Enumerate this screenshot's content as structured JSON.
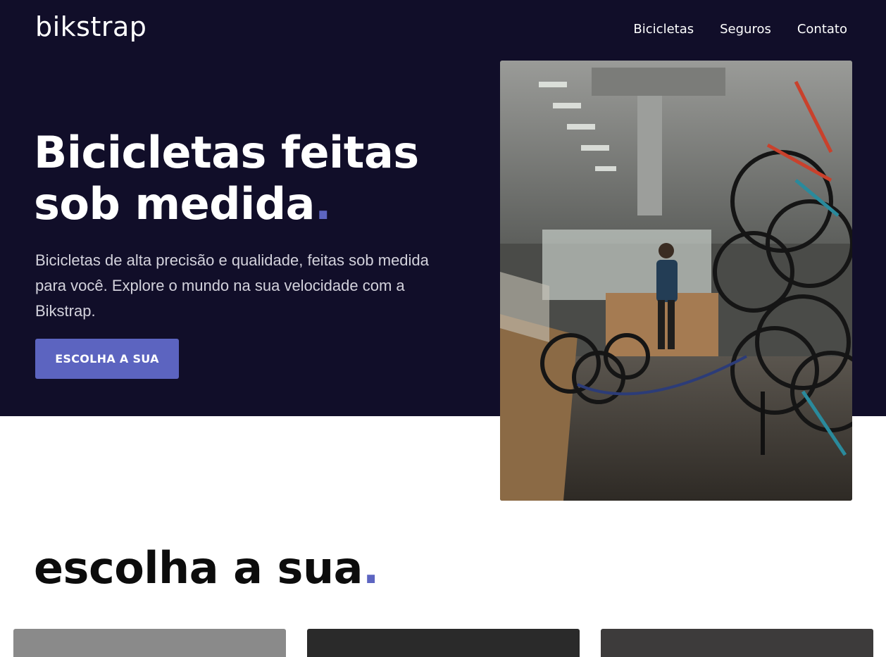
{
  "header": {
    "logo": "bikstrap",
    "nav": [
      "Bicicletas",
      "Seguros",
      "Contato"
    ]
  },
  "hero": {
    "title_line1": "Bicicletas feitas",
    "title_line2": "sob medida",
    "title_dot": ".",
    "description": "Bicicletas de alta precisão e qualidade, feitas sob medida para você. Explore o mundo na sua velocidade com a Bikstrap.",
    "cta_label": "ESCOLHA A SUA"
  },
  "section": {
    "title": "escolha a sua",
    "title_dot": "."
  },
  "colors": {
    "hero_background": "#110e29",
    "accent": "#5c64c0"
  }
}
